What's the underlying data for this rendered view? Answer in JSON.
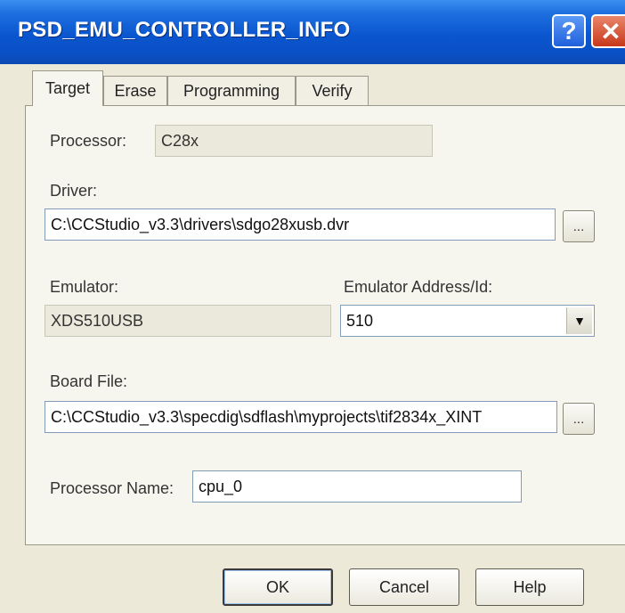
{
  "window": {
    "title": "PSD_EMU_CONTROLLER_INFO",
    "help_glyph": "?",
    "close_glyph": "✕"
  },
  "tabs": [
    {
      "label": "Target",
      "active": true
    },
    {
      "label": "Erase",
      "active": false
    },
    {
      "label": "Programming",
      "active": false
    },
    {
      "label": "Verify",
      "active": false
    }
  ],
  "form": {
    "processor_label": "Processor:",
    "processor_value": "C28x",
    "driver_label": "Driver:",
    "driver_value": "C:\\CCStudio_v3.3\\drivers\\sdgo28xusb.dvr",
    "browse_label": "...",
    "emulator_label": "Emulator:",
    "emulator_value": "XDS510USB",
    "emulator_address_label": "Emulator Address/Id:",
    "emulator_address_value": "510",
    "board_file_label": "Board File:",
    "board_file_value": "C:\\CCStudio_v3.3\\specdig\\sdflash\\myprojects\\tif2834x_XINT",
    "processor_name_label": "Processor Name:",
    "processor_name_value": "cpu_0"
  },
  "buttons": {
    "ok": "OK",
    "cancel": "Cancel",
    "help": "Help"
  },
  "icons": {
    "dropdown": "chevron-down-icon"
  },
  "colors": {
    "titlebar": "#0a56cf",
    "dialog_bg": "#ece9d8",
    "close_red": "#c8381a"
  }
}
